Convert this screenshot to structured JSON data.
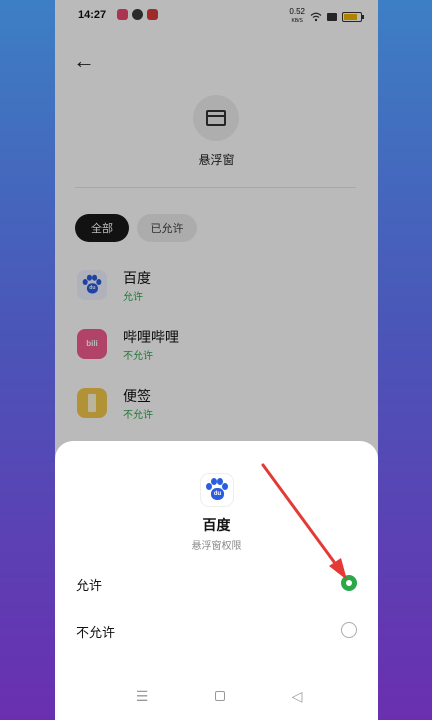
{
  "status_bar": {
    "time": "14:27",
    "network_speed": "0.52",
    "network_unit": "KB/S",
    "app_colors": [
      "#e84a6b",
      "#3a3a3a",
      "#d93a3a"
    ]
  },
  "header": {
    "back_icon": "arrow-left-icon",
    "feature_icon": "floating-window-icon",
    "title": "悬浮窗"
  },
  "filters": {
    "all_label": "全部",
    "allowed_label": "已允许"
  },
  "apps": [
    {
      "name": "百度",
      "status": "允许",
      "icon": "baidu-icon",
      "color": "#f0f4ff"
    },
    {
      "name": "哔哩哔哩",
      "status": "不允许",
      "icon": "bilibili-icon",
      "color": "#f25d8e"
    },
    {
      "name": "便签",
      "status": "不允许",
      "icon": "notes-icon",
      "color": "#f3c84a"
    }
  ],
  "sheet": {
    "app_name": "百度",
    "subtitle": "悬浮窗权限",
    "options": [
      {
        "label": "允许",
        "selected": true
      },
      {
        "label": "不允许",
        "selected": false
      }
    ]
  },
  "navbar": {
    "menu_icon": "menu-icon",
    "home_icon": "home-icon",
    "back_icon": "back-triangle-icon"
  },
  "colors": {
    "accent_green": "#2aa84a",
    "annotation_arrow": "#e53935"
  }
}
